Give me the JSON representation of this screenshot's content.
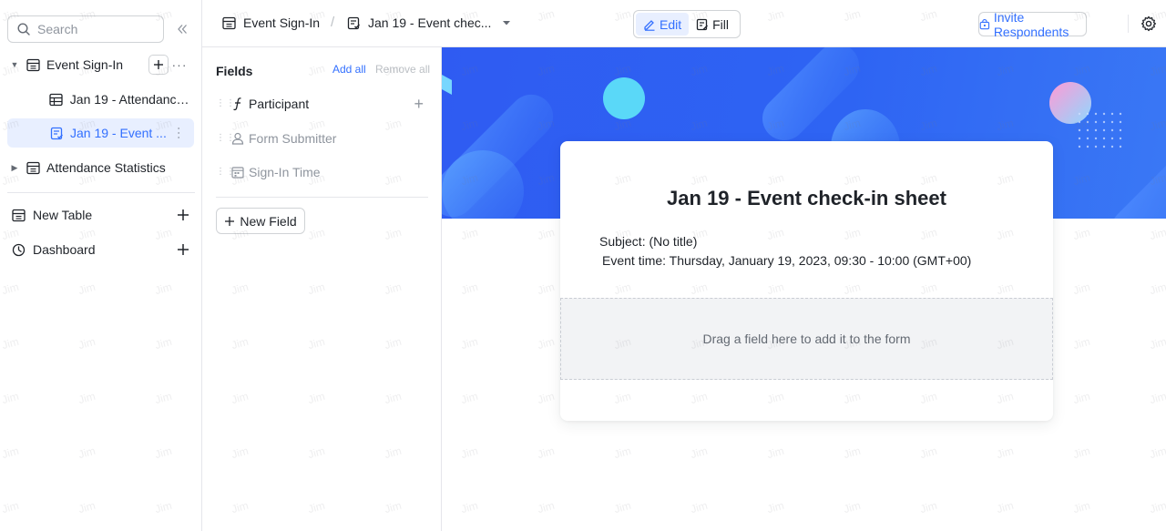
{
  "sidebar": {
    "search_placeholder": "Search",
    "tree": [
      {
        "label": "Event Sign-In",
        "icon": "table-icon"
      },
      {
        "label": "Jan 19 - Attendance ...",
        "icon": "grid-view-icon"
      },
      {
        "label": "Jan 19 - Event ...",
        "icon": "form-icon"
      },
      {
        "label": "Attendance Statistics",
        "icon": "table-icon"
      }
    ],
    "new_table_label": "New Table",
    "dashboard_label": "Dashboard"
  },
  "header": {
    "base_name": "Event Sign-In",
    "form_name": "Jan 19 - Event chec...",
    "edit_label": "Edit",
    "fill_label": "Fill",
    "invite_label": "Invite Respondents"
  },
  "fields_panel": {
    "title": "Fields",
    "add_all": "Add all",
    "remove_all": "Remove all",
    "fields": [
      {
        "label": "Participant",
        "icon": "formula-icon",
        "used": false
      },
      {
        "label": "Form Submitter",
        "icon": "person-icon",
        "used": true
      },
      {
        "label": "Sign-In Time",
        "icon": "calendar-icon",
        "used": true
      }
    ],
    "new_field_label": "New Field"
  },
  "form": {
    "title": "Jan 19 - Event check-in sheet",
    "subject": "Subject: (No title)",
    "event_time": "Event time: Thursday, January 19, 2023, 09:30 - 10:00 (GMT+00)",
    "drop_hint": "Drag a field here to add it to the form"
  },
  "watermark_text": "Jim",
  "colors": {
    "accent": "#3370ff",
    "banner": "#2e64f3",
    "active_bg": "#e8efff"
  }
}
